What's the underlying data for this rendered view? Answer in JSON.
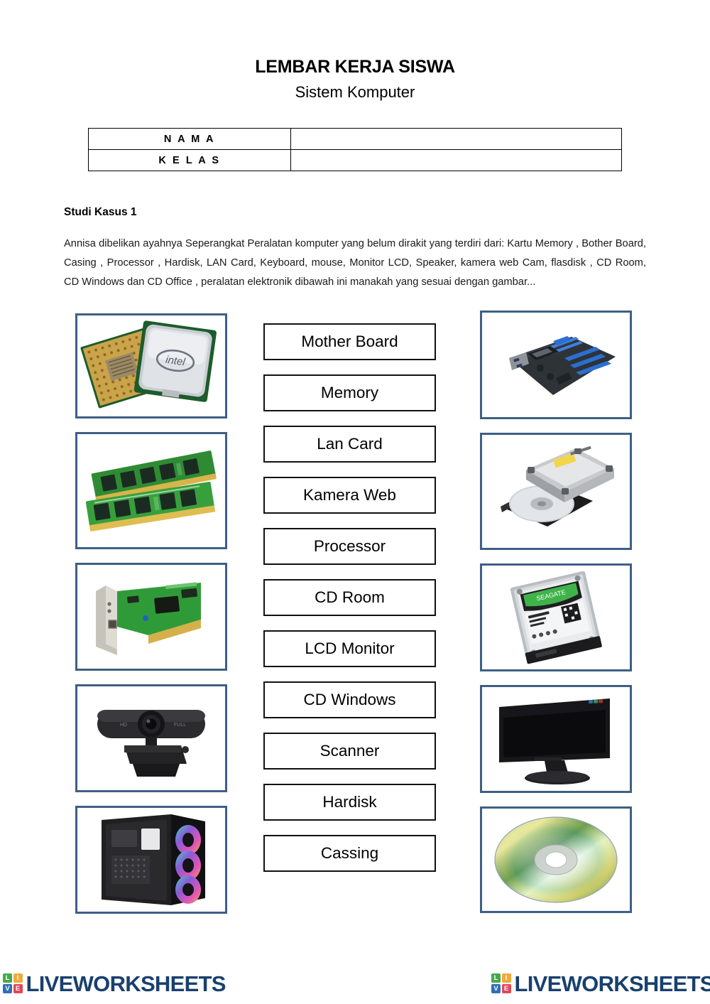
{
  "header": {
    "title": "LEMBAR KERJA SISWA",
    "subtitle": "Sistem Komputer"
  },
  "identity_table": {
    "rows": [
      {
        "label": "N A M A",
        "value": ""
      },
      {
        "label": "K E L A S",
        "value": ""
      }
    ]
  },
  "case_study": {
    "heading": "Studi Kasus 1",
    "paragraph": "Annisa  dibelikan  ayahnya Seperangkat  Peralatan komputer yang belum dirakit  yang terdiri dari: Kartu Memory , Bother Board, Casing , Processor , Hardisk, LAN Card, Keyboard, mouse, Monitor LCD, Speaker, kamera web Cam, flasdisk ,  CD Room, CD Windows dan CD Office  , peralatan elektronik dibawah ini manakah yang sesuai dengan gambar..."
  },
  "matching": {
    "labels": [
      {
        "text": "Mother Board"
      },
      {
        "text": "Memory"
      },
      {
        "text": "Lan Card"
      },
      {
        "text": "Kamera Web"
      },
      {
        "text": "Processor"
      },
      {
        "text": "CD Room"
      },
      {
        "text": "LCD Monitor"
      },
      {
        "text": "CD Windows"
      },
      {
        "text": "Scanner"
      },
      {
        "text": "Hardisk"
      },
      {
        "text": "Cassing"
      }
    ],
    "left_images": [
      {
        "name": "processor-cpu-photo",
        "alt": "Intel processor CPU chips"
      },
      {
        "name": "memory-ram-photo",
        "alt": "Green RAM memory modules"
      },
      {
        "name": "lan-card-photo",
        "alt": "PCI LAN network card"
      },
      {
        "name": "webcam-photo",
        "alt": "Black USB web camera"
      },
      {
        "name": "pc-case-photo",
        "alt": "Black PC case with RGB fans"
      }
    ],
    "right_images": [
      {
        "name": "motherboard-photo",
        "alt": "Blue ATX motherboard"
      },
      {
        "name": "cd-rom-drive-photo",
        "alt": "Optical CD ROM drive with open tray"
      },
      {
        "name": "hard-disk-photo",
        "alt": "Seagate 3.5 inch hard disk drive"
      },
      {
        "name": "lcd-monitor-photo",
        "alt": "Black widescreen LCD monitor"
      },
      {
        "name": "cd-disc-photo",
        "alt": "Iridescent compact disc"
      }
    ]
  },
  "footer": {
    "logos": [
      {
        "tiles": [
          "L",
          "I",
          "V",
          "E"
        ],
        "word": "LIVEWORKSHEETS"
      },
      {
        "tiles": [
          "L",
          "I",
          "V",
          "E"
        ],
        "word": "LIVEWORKSHEETS"
      }
    ],
    "brand_color": "#19406e"
  },
  "colors": {
    "frame_border": "#3f5f86",
    "label_border": "#111111",
    "text": "#000000"
  }
}
